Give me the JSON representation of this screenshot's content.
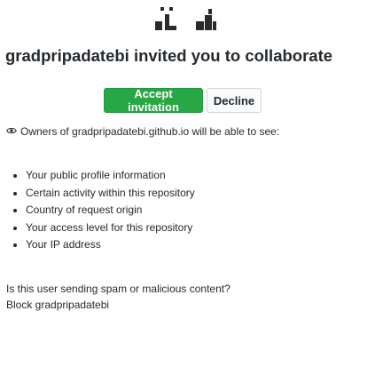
{
  "invite": {
    "inviter": "gradpripadatebi",
    "headline": "gradpripadatebi invited you to collaborate",
    "accept_label": "Accept invitation",
    "decline_label": "Decline"
  },
  "notice": {
    "icon": "eye-icon",
    "text": "Owners of gradpripadatebi.github.io will be able to see:"
  },
  "permissions": [
    "Your public profile information",
    "Certain activity within this repository",
    "Country of request origin",
    "Your access level for this repository",
    "Your IP address"
  ],
  "spam": {
    "question": "Is this user sending spam or malicious content?",
    "block_label": "Block gradpripadatebi"
  },
  "colors": {
    "primary": "#28a745",
    "text": "#24292e"
  }
}
